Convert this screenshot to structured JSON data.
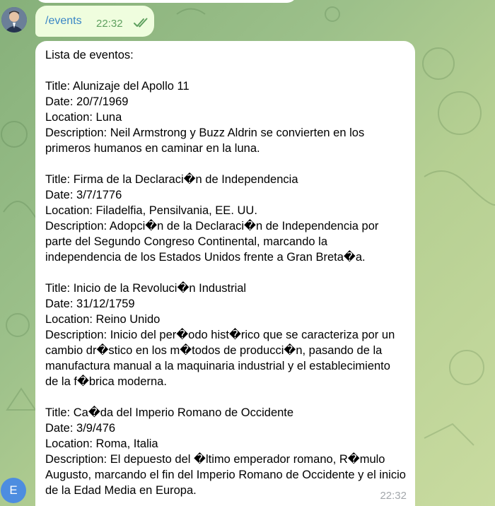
{
  "chat": {
    "outgoing": {
      "text": "/events",
      "time": "22:32",
      "status_icon": "double-check-icon"
    },
    "incoming": {
      "text": "Lista de eventos:\n\nTitle: Alunizaje del Apollo 11\nDate: 20/7/1969\nLocation: Luna\nDescription: Neil Armstrong y Buzz Aldrin se convierten en los primeros humanos en caminar en la luna.\n\nTitle: Firma de la Declaraci�n de Independencia\nDate: 3/7/1776\nLocation: Filadelfia, Pensilvania, EE. UU.\nDescription: Adopci�n de la Declaraci�n de Independencia por parte del Segundo Congreso Continental, marcando la independencia de los Estados Unidos frente a Gran Breta�a.\n\nTitle: Inicio de la Revoluci�n Industrial\nDate: 31/12/1759\nLocation: Reino Unido\nDescription: Inicio del per�odo hist�rico que se caracteriza por un cambio dr�stico en los m�todos de producci�n, pasando de la manufactura manual a la maquinaria industrial y el establecimiento de la f�brica moderna.\n\nTitle: Ca�da del Imperio Romano de Occidente\nDate: 3/9/476\nLocation: Roma, Italia\nDescription: El depuesto del �ltimo emperador romano, R�mulo Augusto, marcando el fin del Imperio Romano de Occidente y el inicio de la Edad Media en Europa.",
      "time": "22:32"
    },
    "bot_avatar_letter": "E"
  },
  "colors": {
    "outgoing_bubble": "#effdde",
    "incoming_bubble": "#ffffff",
    "link_blue": "#3a86c6",
    "read_green": "#5fa05f",
    "avatar_blue": "#4d8de0"
  }
}
